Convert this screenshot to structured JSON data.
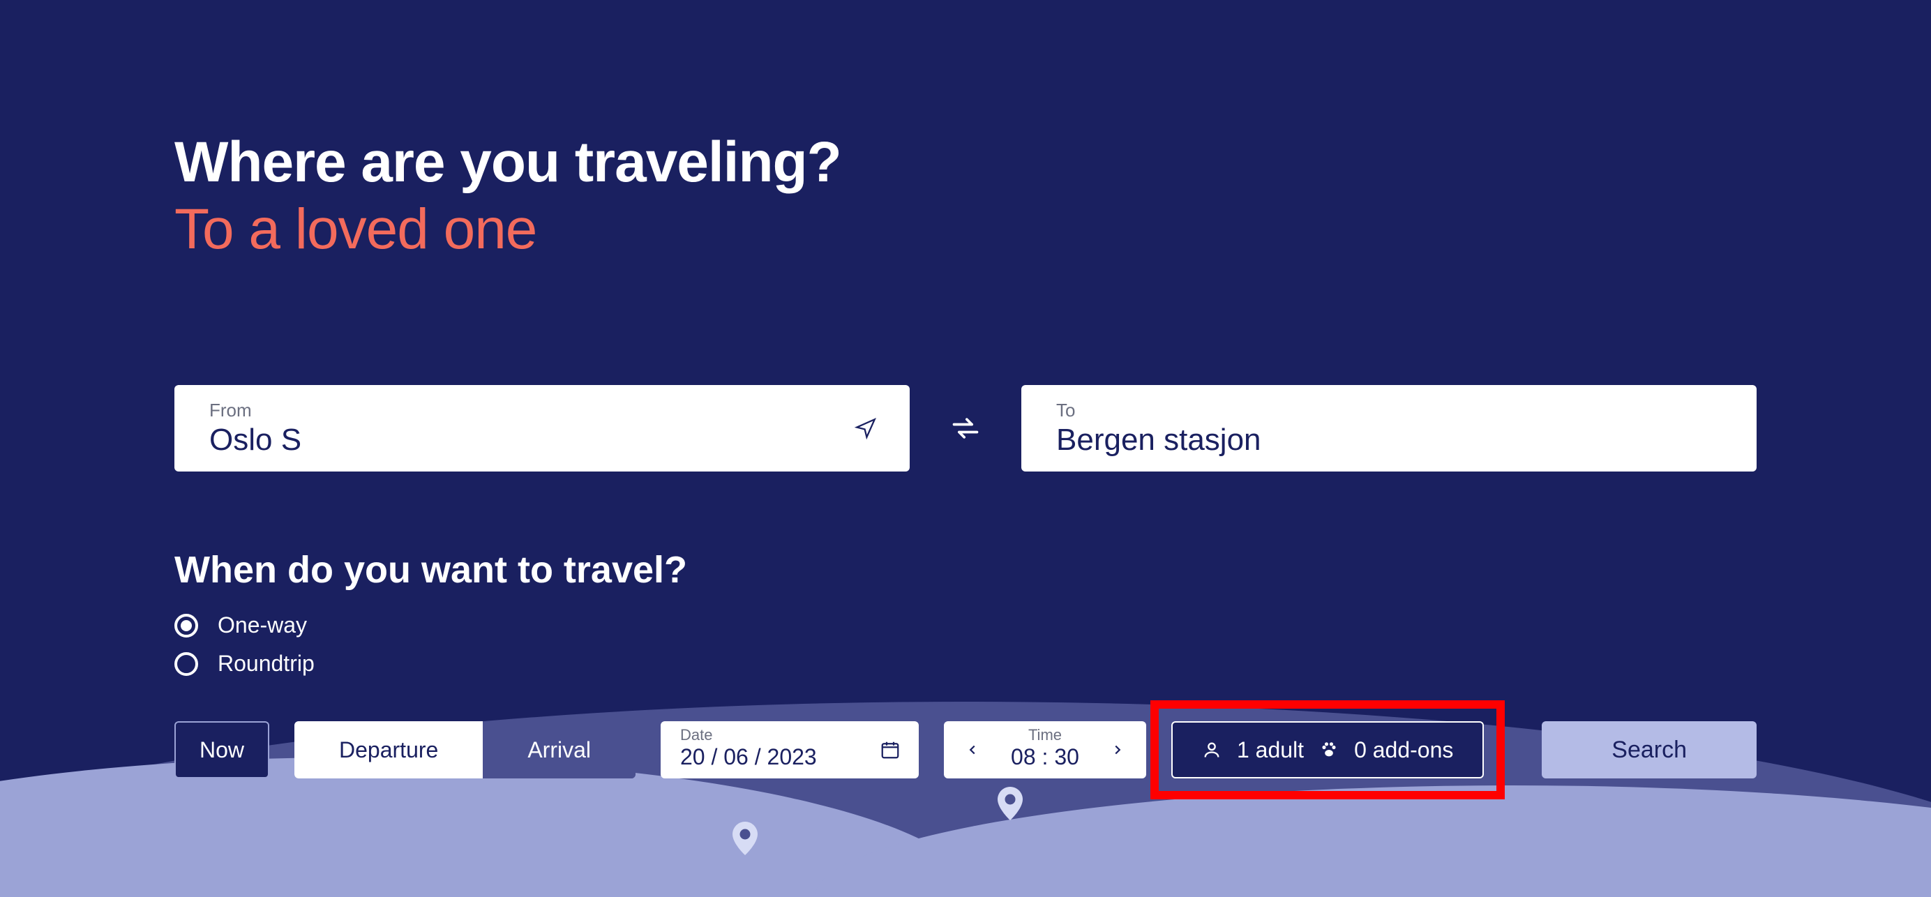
{
  "heading": {
    "title": "Where are you traveling?",
    "tagline": "To a loved one"
  },
  "stations": {
    "from_label": "From",
    "from_value": "Oslo S",
    "to_label": "To",
    "to_value": "Bergen stasjon"
  },
  "when": {
    "heading": "When do you want to travel?",
    "oneway_label": "One-way",
    "roundtrip_label": "Roundtrip",
    "selected_trip_type": "oneway"
  },
  "controls": {
    "now_label": "Now",
    "departure_label": "Departure",
    "arrival_label": "Arrival",
    "date_label": "Date",
    "date_value": "20 / 06 / 2023",
    "time_label": "Time",
    "time_value": "08 : 30",
    "passengers_person_text": "1 adult",
    "passengers_addons_text": "0 add-ons",
    "search_label": "Search"
  },
  "colors": {
    "bg": "#1a2060",
    "accent": "#f36b5c",
    "hill_back": "#4a5090",
    "hill_front": "#9ba3d6",
    "highlight": "#ff0000"
  }
}
